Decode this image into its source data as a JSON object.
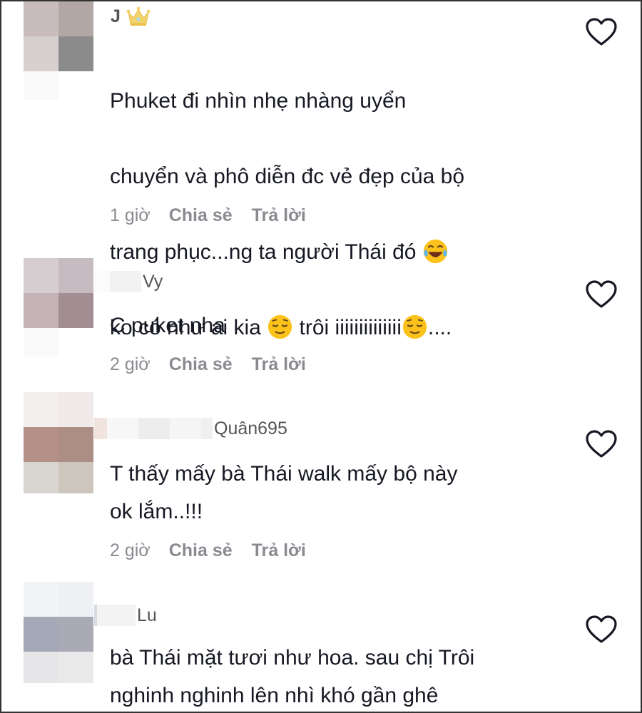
{
  "comments": [
    {
      "username": "J",
      "lines": [
        "Phuket đi nhìn nhẹ nhàng uyển",
        "chuyển và phô diễn đc vẻ đẹp của bộ"
      ],
      "line3": "trang phục...ng ta người Thái đó ",
      "line4a": "ko có như ai kia ",
      "line4b": " trôi iiiiiiiiiiiiii",
      "line4c": "....",
      "time": "1 giờ",
      "share": "Chia sẻ",
      "reply": "Trả lời"
    },
    {
      "username": "Vy",
      "text": "C puket nha",
      "time": "2 giờ",
      "share": "Chia sẻ",
      "reply": "Trả lời"
    },
    {
      "username": "Quân695",
      "text": "T thấy mấy bà Thái walk mấy bộ này\nok lắm..!!!",
      "time": "2 giờ",
      "share": "Chia sẻ",
      "reply": "Trả lời"
    },
    {
      "username": "Lu",
      "text": "bà Thái mặt tươi như hoa. sau chị Trôi\nnghinh nghinh lên nhì khó gần ghê"
    }
  ],
  "icons": {
    "badge": "crown-icon",
    "like": "heart-outline-icon",
    "emoji_laugh": "face-tears-of-joy-icon",
    "emoji_relieved": "relieved-face-icon"
  },
  "colors": {
    "text": "#161823",
    "meta": "#8a8b91",
    "username": "#555555",
    "heart": "#161823"
  }
}
